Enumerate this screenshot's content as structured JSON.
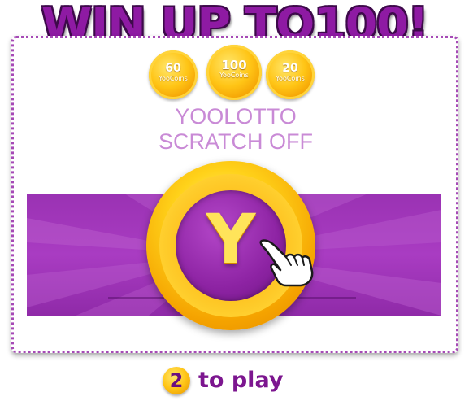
{
  "headline": "WIN UP TO100!",
  "prize_coins": [
    {
      "amount": "60",
      "unit": "YooCoins"
    },
    {
      "amount": "100",
      "unit": "YooCoins"
    },
    {
      "amount": "20",
      "unit": "YooCoins"
    }
  ],
  "game_title": {
    "line1": "YOOLOTTO",
    "line2": "SCRATCH OFF"
  },
  "scratch_coin": {
    "letter": "Y"
  },
  "footer": {
    "cost": "2",
    "text": "to play"
  },
  "colors": {
    "purple": "#8e1aa3",
    "gold": "#ffc516",
    "lavender_text": "#c98ad6"
  },
  "icons": [
    "pointing-hand-cursor-icon",
    "yoocoin-icon"
  ]
}
